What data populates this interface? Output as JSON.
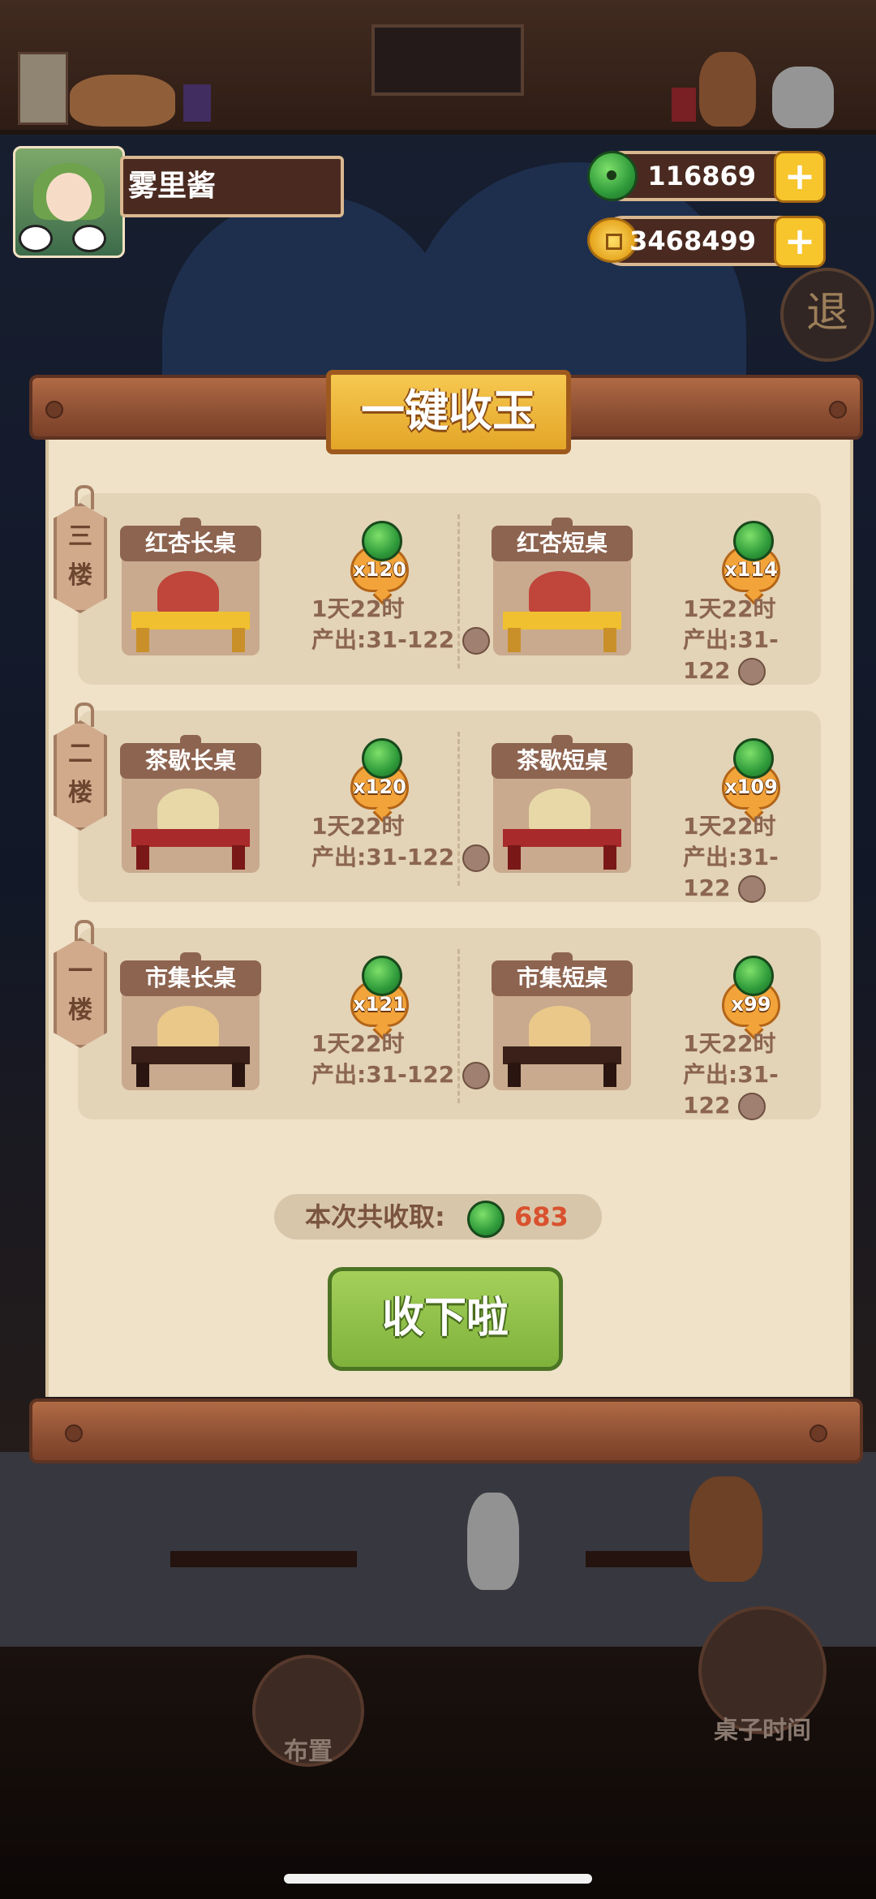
{
  "player": {
    "name": "雾里酱"
  },
  "currencies": {
    "jade": {
      "value": "116869",
      "icon": "jade-icon"
    },
    "coins": {
      "value": "3468499",
      "icon": "coin-icon"
    }
  },
  "exit_label": "退",
  "dialog": {
    "title": "一键收玉",
    "floors": [
      {
        "floor_label": "三楼",
        "tables": [
          {
            "name": "红杏长桌",
            "count": "x120",
            "time": "1天22时",
            "output": "产出:31-122"
          },
          {
            "name": "红杏短桌",
            "count": "x114",
            "time": "1天22时",
            "output": "产出:31-122"
          }
        ]
      },
      {
        "floor_label": "二楼",
        "tables": [
          {
            "name": "茶歇长桌",
            "count": "x120",
            "time": "1天22时",
            "output": "产出:31-122"
          },
          {
            "name": "茶歇短桌",
            "count": "x109",
            "time": "1天22时",
            "output": "产出:31-122"
          }
        ]
      },
      {
        "floor_label": "一楼",
        "tables": [
          {
            "name": "市集长桌",
            "count": "x121",
            "time": "1天22时",
            "output": "产出:31-122"
          },
          {
            "name": "市集短桌",
            "count": "x99",
            "time": "1天22时",
            "output": "产出:31-122"
          }
        ]
      }
    ],
    "summary_label": "本次共收取:",
    "summary_value": "683",
    "collect_button": "收下啦"
  },
  "bottom_nav": {
    "layout_label": "布置",
    "table_time_label": "桌子时间"
  },
  "colors": {
    "accent_gold": "#f7c52c",
    "jade_green": "#2e9a3a",
    "collect_green": "#8cc044",
    "summary_red": "#d9512e"
  }
}
